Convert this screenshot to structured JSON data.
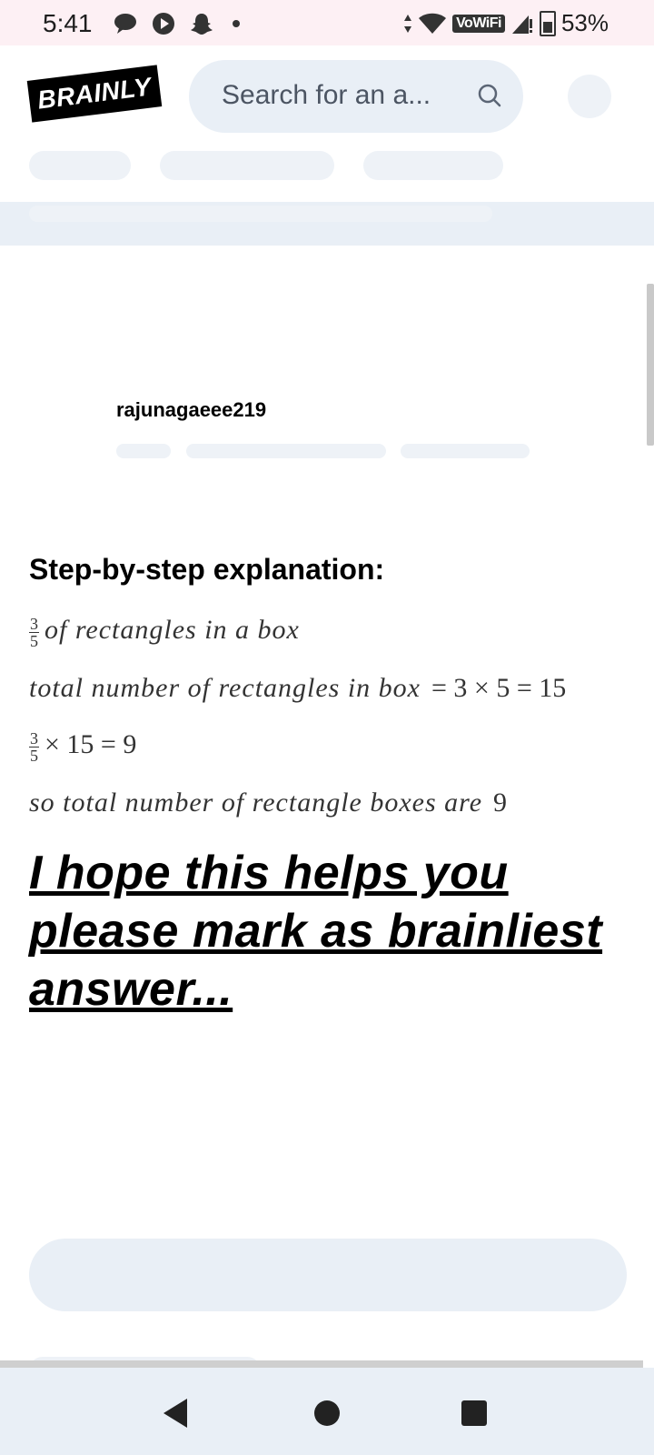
{
  "status_bar": {
    "time": "5:41",
    "left_icons": [
      "chat-icon",
      "play-icon",
      "snapchat-icon",
      "dot-icon"
    ],
    "vowifi": "VoWiFi",
    "battery": "53%"
  },
  "header": {
    "logo": "BRAINLY",
    "search_placeholder": "Search for an a..."
  },
  "answer": {
    "username": "rajunagaeee219",
    "heading": "Step-by-step explanation:",
    "lines": {
      "l1_num": "3",
      "l1_den": "5",
      "l1_text": "of rectangles in a box",
      "l2_text": "total number of rectangles in box",
      "l2_expr": "= 3 × 5 = 15",
      "l3_num": "3",
      "l3_den": "5",
      "l3_expr": "× 15 = 9",
      "l4_text": "so total number of rectangle boxes are",
      "l4_value": "9"
    },
    "closing": "I hope this helps you please mark as brainliest answer..."
  }
}
